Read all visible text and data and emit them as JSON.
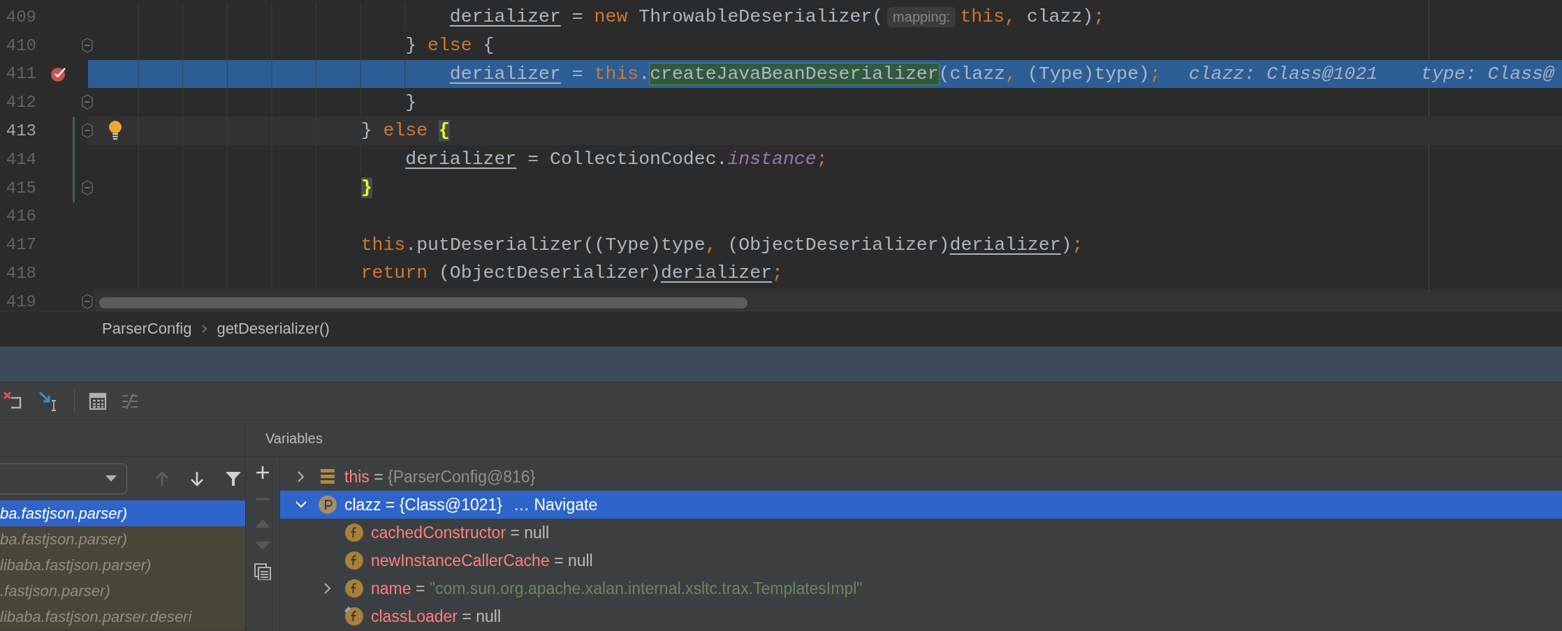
{
  "editor": {
    "lines": [
      {
        "number": "409",
        "current_line": false,
        "execution_point": false,
        "fold": false,
        "breakpoint": false,
        "bulb": false,
        "changed": false,
        "tokens": [
          {
            "kind": "field",
            "text": "                                derializer"
          },
          {
            "kind": "plain",
            "text": " = "
          },
          {
            "kind": "keyword",
            "text": "new"
          },
          {
            "kind": "plain",
            "text": " ThrowableDeserializer("
          },
          {
            "kind": "hint",
            "text": "mapping:"
          },
          {
            "kind": "keyword",
            "text": "this,"
          },
          {
            "kind": "plain",
            "text": " clazz)"
          },
          {
            "kind": "keyword",
            "text": ";"
          }
        ]
      },
      {
        "number": "410",
        "current_line": false,
        "execution_point": false,
        "fold": true,
        "breakpoint": false,
        "bulb": false,
        "changed": false,
        "tokens": [
          {
            "kind": "plain",
            "text": "                            } "
          },
          {
            "kind": "keyword",
            "text": "else"
          },
          {
            "kind": "plain",
            "text": " {"
          }
        ]
      },
      {
        "number": "411",
        "current_line": false,
        "execution_point": true,
        "fold": false,
        "breakpoint": true,
        "bulb": false,
        "changed": false,
        "tokens": [
          {
            "kind": "field",
            "text": "                                derializer"
          },
          {
            "kind": "plain",
            "text": " = "
          },
          {
            "kind": "keyword",
            "text": "this"
          },
          {
            "kind": "plain",
            "text": "."
          },
          {
            "kind": "method-match",
            "text": "createJavaBeanDeserializer"
          },
          {
            "kind": "plain",
            "text": "(clazz"
          },
          {
            "kind": "keyword",
            "text": ","
          },
          {
            "kind": "plain",
            "text": " (Type)type)"
          },
          {
            "kind": "keyword",
            "text": ";"
          },
          {
            "kind": "debug",
            "text": "clazz: Class@1021"
          },
          {
            "kind": "debug",
            "text": "type: Class@"
          }
        ]
      },
      {
        "number": "412",
        "current_line": false,
        "execution_point": false,
        "fold": true,
        "breakpoint": false,
        "bulb": false,
        "changed": false,
        "tokens": [
          {
            "kind": "plain",
            "text": "                            }"
          }
        ]
      },
      {
        "number": "413",
        "current_line": true,
        "execution_point": false,
        "fold": true,
        "breakpoint": false,
        "bulb": true,
        "changed": true,
        "tokens": [
          {
            "kind": "plain",
            "text": "                        } "
          },
          {
            "kind": "keyword",
            "text": "else "
          },
          {
            "kind": "brace-match",
            "text": "{"
          }
        ]
      },
      {
        "number": "414",
        "current_line": false,
        "execution_point": false,
        "fold": false,
        "breakpoint": false,
        "bulb": false,
        "changed": true,
        "tokens": [
          {
            "kind": "field",
            "text": "                            derializer"
          },
          {
            "kind": "plain",
            "text": " = CollectionCodec."
          },
          {
            "kind": "static",
            "text": "instance"
          },
          {
            "kind": "keyword",
            "text": ";"
          }
        ]
      },
      {
        "number": "415",
        "current_line": false,
        "execution_point": false,
        "fold": true,
        "breakpoint": false,
        "bulb": false,
        "changed": true,
        "tokens": [
          {
            "kind": "brace-match",
            "text": "                        }"
          }
        ]
      },
      {
        "number": "416",
        "current_line": false,
        "execution_point": false,
        "fold": false,
        "breakpoint": false,
        "bulb": false,
        "changed": false
      },
      {
        "number": "417",
        "current_line": false,
        "execution_point": false,
        "fold": false,
        "breakpoint": false,
        "bulb": false,
        "changed": false,
        "tokens": [
          {
            "kind": "keyword",
            "text": "                        this"
          },
          {
            "kind": "plain",
            "text": ".putDeserializer((Type)type"
          },
          {
            "kind": "keyword",
            "text": ","
          },
          {
            "kind": "plain",
            "text": " (ObjectDeserializer)"
          },
          {
            "kind": "field",
            "text": "derializer"
          },
          {
            "kind": "plain",
            "text": ")"
          },
          {
            "kind": "keyword",
            "text": ";"
          }
        ]
      },
      {
        "number": "418",
        "current_line": false,
        "execution_point": false,
        "fold": false,
        "breakpoint": false,
        "bulb": false,
        "changed": false,
        "tokens": [
          {
            "kind": "keyword",
            "text": "                        return"
          },
          {
            "kind": "plain",
            "text": " (ObjectDeserializer)"
          },
          {
            "kind": "field",
            "text": "derializer"
          },
          {
            "kind": "keyword",
            "text": ";"
          }
        ]
      },
      {
        "number": "419",
        "current_line": false,
        "execution_point": false,
        "fold": true,
        "breakpoint": false,
        "bulb": false,
        "changed": false
      }
    ]
  },
  "breadcrumbs": [
    "ParserConfig",
    "getDeserializer()"
  ],
  "frames_panel": {
    "frames": [
      {
        "text": "ba.fastjson.parser)",
        "selected": true
      },
      {
        "text": "ba.fastjson.parser)",
        "selected": false
      },
      {
        "text": "libaba.fastjson.parser)",
        "selected": false
      },
      {
        "text": ".fastjson.parser)",
        "selected": false
      },
      {
        "text": "libaba.fastjson.parser.deseri",
        "selected": false
      }
    ]
  },
  "variables_panel": {
    "title": "Variables",
    "items": [
      {
        "kind": "object",
        "name": "this",
        "operator": "=",
        "value": {
          "kind": "object",
          "text": "{ParserConfig@816}"
        },
        "expanded": false,
        "selected": false
      },
      {
        "kind": "parameter",
        "name": "clazz",
        "operator": "=",
        "value": {
          "kind": "object",
          "text": "{Class@1021}"
        },
        "link": "… Navigate",
        "expanded": true,
        "selected": true,
        "children": [
          {
            "kind": "field",
            "name": "cachedConstructor",
            "operator": "=",
            "value": {
              "kind": "null",
              "text": "null"
            },
            "selected": false
          },
          {
            "kind": "field",
            "name": "newInstanceCallerCache",
            "operator": "=",
            "value": {
              "kind": "null",
              "text": "null"
            },
            "selected": false
          },
          {
            "kind": "field",
            "name": "name",
            "operator": "=",
            "value": {
              "kind": "string",
              "text": "\"com.sun.org.apache.xalan.internal.xsltc.trax.TemplatesImpl\""
            },
            "expanded": false,
            "selected": false
          },
          {
            "kind": "pinned-field",
            "name": "classLoader",
            "operator": "=",
            "value": {
              "kind": "null",
              "text": "null"
            },
            "selected": false
          }
        ]
      }
    ]
  }
}
